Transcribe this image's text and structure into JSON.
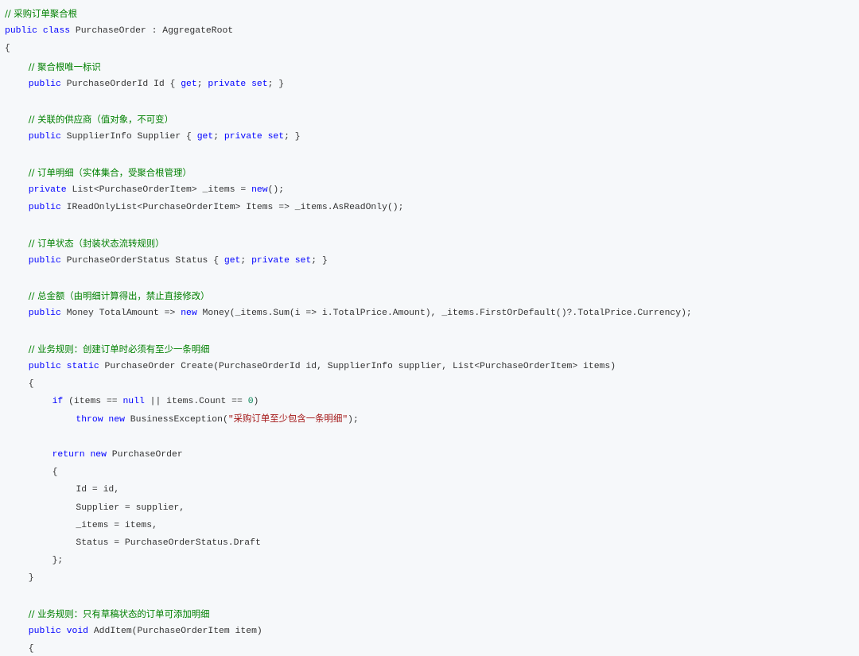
{
  "colors": {
    "background": "#f6f8fa",
    "keyword": "#0000ff",
    "comment": "#008000",
    "string": "#a31515",
    "number": "#098658",
    "text": "#333333"
  },
  "code_lines": [
    {
      "indent": 0,
      "tokens": [
        [
          "cm",
          "// 采购订单聚合根"
        ]
      ]
    },
    {
      "indent": 0,
      "tokens": [
        [
          "kw",
          "public"
        ],
        [
          "id",
          " "
        ],
        [
          "kw",
          "class"
        ],
        [
          "id",
          " PurchaseOrder : AggregateRoot"
        ]
      ]
    },
    {
      "indent": 0,
      "tokens": [
        [
          "id",
          "{"
        ]
      ]
    },
    {
      "indent": 1,
      "tokens": [
        [
          "cm",
          "// 聚合根唯一标识"
        ]
      ]
    },
    {
      "indent": 1,
      "tokens": [
        [
          "kw",
          "public"
        ],
        [
          "id",
          " PurchaseOrderId Id { "
        ],
        [
          "kw",
          "get"
        ],
        [
          "id",
          "; "
        ],
        [
          "kw",
          "private"
        ],
        [
          "id",
          " "
        ],
        [
          "kw",
          "set"
        ],
        [
          "id",
          "; }"
        ]
      ]
    },
    {
      "indent": 0,
      "tokens": []
    },
    {
      "indent": 1,
      "tokens": [
        [
          "cm",
          "// 关联的供应商（值对象，不可变）"
        ]
      ]
    },
    {
      "indent": 1,
      "tokens": [
        [
          "kw",
          "public"
        ],
        [
          "id",
          " SupplierInfo Supplier { "
        ],
        [
          "kw",
          "get"
        ],
        [
          "id",
          "; "
        ],
        [
          "kw",
          "private"
        ],
        [
          "id",
          " "
        ],
        [
          "kw",
          "set"
        ],
        [
          "id",
          "; }"
        ]
      ]
    },
    {
      "indent": 0,
      "tokens": []
    },
    {
      "indent": 1,
      "tokens": [
        [
          "cm",
          "// 订单明细（实体集合，受聚合根管理）"
        ]
      ]
    },
    {
      "indent": 1,
      "tokens": [
        [
          "kw",
          "private"
        ],
        [
          "id",
          " List<PurchaseOrderItem> _items = "
        ],
        [
          "kw",
          "new"
        ],
        [
          "id",
          "();"
        ]
      ]
    },
    {
      "indent": 1,
      "tokens": [
        [
          "kw",
          "public"
        ],
        [
          "id",
          " IReadOnlyList<PurchaseOrderItem> Items => _items.AsReadOnly();"
        ]
      ]
    },
    {
      "indent": 0,
      "tokens": []
    },
    {
      "indent": 1,
      "tokens": [
        [
          "cm",
          "// 订单状态（封装状态流转规则）"
        ]
      ]
    },
    {
      "indent": 1,
      "tokens": [
        [
          "kw",
          "public"
        ],
        [
          "id",
          " PurchaseOrderStatus Status { "
        ],
        [
          "kw",
          "get"
        ],
        [
          "id",
          "; "
        ],
        [
          "kw",
          "private"
        ],
        [
          "id",
          " "
        ],
        [
          "kw",
          "set"
        ],
        [
          "id",
          "; }"
        ]
      ]
    },
    {
      "indent": 0,
      "tokens": []
    },
    {
      "indent": 1,
      "tokens": [
        [
          "cm",
          "// 总金额（由明细计算得出，禁止直接修改）"
        ]
      ]
    },
    {
      "indent": 1,
      "tokens": [
        [
          "kw",
          "public"
        ],
        [
          "id",
          " Money TotalAmount => "
        ],
        [
          "kw",
          "new"
        ],
        [
          "id",
          " Money(_items.Sum(i => i.TotalPrice.Amount), _items.FirstOrDefault()?.TotalPrice.Currency);"
        ]
      ]
    },
    {
      "indent": 0,
      "tokens": []
    },
    {
      "indent": 1,
      "tokens": [
        [
          "cm",
          "// 业务规则：创建订单时必须有至少一条明细"
        ]
      ]
    },
    {
      "indent": 1,
      "tokens": [
        [
          "kw",
          "public"
        ],
        [
          "id",
          " "
        ],
        [
          "kw",
          "static"
        ],
        [
          "id",
          " PurchaseOrder Create(PurchaseOrderId id, SupplierInfo supplier, List<PurchaseOrderItem> items)"
        ]
      ]
    },
    {
      "indent": 1,
      "tokens": [
        [
          "id",
          "{"
        ]
      ]
    },
    {
      "indent": 2,
      "tokens": [
        [
          "kw",
          "if"
        ],
        [
          "id",
          " (items == "
        ],
        [
          "kw",
          "null"
        ],
        [
          "id",
          " || items.Count == "
        ],
        [
          "num",
          "0"
        ],
        [
          "id",
          ")"
        ]
      ]
    },
    {
      "indent": 3,
      "tokens": [
        [
          "kw",
          "throw"
        ],
        [
          "id",
          " "
        ],
        [
          "kw",
          "new"
        ],
        [
          "id",
          " BusinessException("
        ],
        [
          "str",
          "\"采购订单至少包含一条明细\""
        ],
        [
          "id",
          ");"
        ]
      ]
    },
    {
      "indent": 0,
      "tokens": []
    },
    {
      "indent": 2,
      "tokens": [
        [
          "kw",
          "return"
        ],
        [
          "id",
          " "
        ],
        [
          "kw",
          "new"
        ],
        [
          "id",
          " PurchaseOrder"
        ]
      ]
    },
    {
      "indent": 2,
      "tokens": [
        [
          "id",
          "{"
        ]
      ]
    },
    {
      "indent": 3,
      "tokens": [
        [
          "id",
          "Id = id,"
        ]
      ]
    },
    {
      "indent": 3,
      "tokens": [
        [
          "id",
          "Supplier = supplier,"
        ]
      ]
    },
    {
      "indent": 3,
      "tokens": [
        [
          "id",
          "_items = items,"
        ]
      ]
    },
    {
      "indent": 3,
      "tokens": [
        [
          "id",
          "Status = PurchaseOrderStatus.Draft"
        ]
      ]
    },
    {
      "indent": 2,
      "tokens": [
        [
          "id",
          "};"
        ]
      ]
    },
    {
      "indent": 1,
      "tokens": [
        [
          "id",
          "}"
        ]
      ]
    },
    {
      "indent": 0,
      "tokens": []
    },
    {
      "indent": 1,
      "tokens": [
        [
          "cm",
          "// 业务规则：只有草稿状态的订单可添加明细"
        ]
      ]
    },
    {
      "indent": 1,
      "tokens": [
        [
          "kw",
          "public"
        ],
        [
          "id",
          " "
        ],
        [
          "kw",
          "void"
        ],
        [
          "id",
          " AddItem(PurchaseOrderItem item)"
        ]
      ]
    },
    {
      "indent": 1,
      "tokens": [
        [
          "id",
          "{"
        ]
      ]
    }
  ]
}
